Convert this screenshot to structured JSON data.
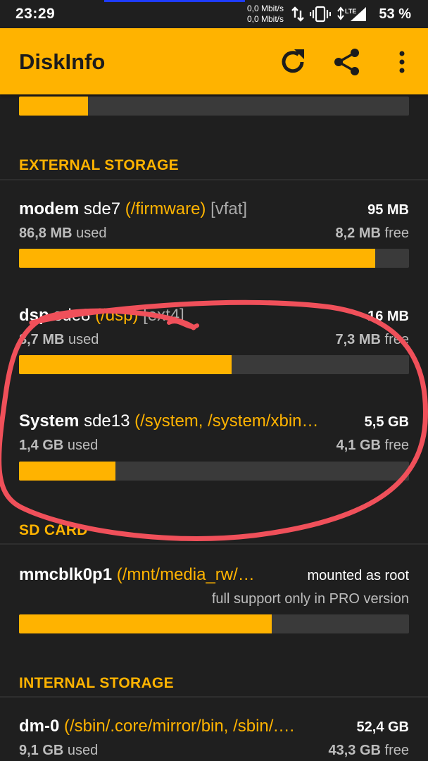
{
  "status_bar": {
    "time": "23:29",
    "net_up": "0,0 Mbit/s",
    "net_down": "0,0 Mbit/s",
    "lte_label": "LTE",
    "battery": "53 %"
  },
  "app_bar": {
    "title": "DiskInfo",
    "icons": [
      "refresh-icon",
      "share-icon",
      "more-vert-icon"
    ]
  },
  "top_partial_bar": {
    "fill_fraction": 0.177
  },
  "sections": {
    "external": {
      "header": "EXTERNAL STORAGE",
      "items": [
        {
          "name": "modem",
          "device": "sde7",
          "mount": "(/firmware)",
          "fs": "[vfat]",
          "total": "95 MB",
          "used_value": "86,8 MB",
          "used_label": "used",
          "free_value": "8,2 MB",
          "free_label": "free",
          "fill_fraction": 0.914
        },
        {
          "name": "dsp",
          "device": "sde8",
          "mount": "(/dsp)",
          "fs": "[ext4]",
          "total": "16 MB",
          "used_value": "8,7 MB",
          "used_label": "used",
          "free_value": "7,3 MB",
          "free_label": "free",
          "fill_fraction": 0.546
        },
        {
          "name": "System",
          "device": "sde13",
          "mount": "(/system, /system/xbin…",
          "fs": "",
          "total": "5,5 GB",
          "used_value": "1,4 GB",
          "used_label": "used",
          "free_value": "4,1 GB",
          "free_label": "free",
          "fill_fraction": 0.247
        }
      ]
    },
    "sd_card": {
      "header": "SD CARD",
      "item": {
        "name": "mmcblk0p1",
        "mount": "(/mnt/media_rw/…",
        "right_top": "mounted as root",
        "right_bottom": "full support only in PRO version",
        "fill_fraction": 0.648
      }
    },
    "internal": {
      "header": "INTERNAL STORAGE",
      "item": {
        "name": "dm-0",
        "mount": "(/sbin/.core/mirror/bin, /sbin/.…",
        "total": "52,4 GB",
        "used_value": "9,1 GB",
        "used_label": "used",
        "free_value": "43,3 GB",
        "free_label": "free"
      }
    }
  },
  "colors": {
    "accent": "#ffb300",
    "background": "#1f1f1f",
    "bar_track": "#3a3a3a",
    "annotation": "#f0505a"
  }
}
